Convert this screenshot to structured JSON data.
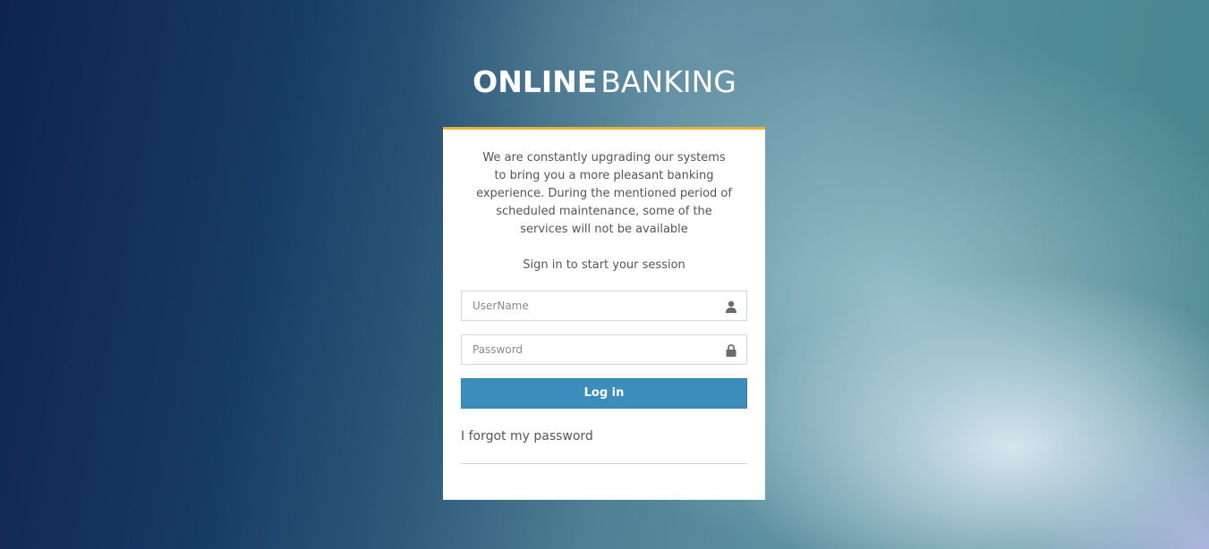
{
  "brand": {
    "title_bold": "ONLINE",
    "title_light": "BANKING"
  },
  "login_box": {
    "notice": "We are constantly upgrading our systems to bring you a more pleasant banking experience. During the mentioned period of scheduled maintenance, some of the services will not be available",
    "message": "Sign in to start your session",
    "username": {
      "placeholder": "UserName",
      "value": "",
      "icon": "user-icon"
    },
    "password": {
      "placeholder": "Password",
      "value": "",
      "icon": "lock-icon"
    },
    "login_label": "Log in",
    "forgot_label": "I forgot my password"
  },
  "colors": {
    "accent_top_border": "#f0b233",
    "button": "#3c8dbc"
  }
}
